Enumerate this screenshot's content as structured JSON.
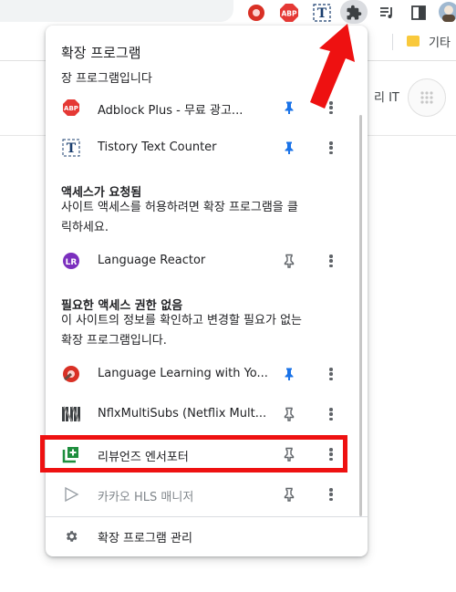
{
  "popup": {
    "title": "확장 프로그램",
    "subtitle": "장 프로그램입니다",
    "pinned": [
      {
        "name": "Adblock Plus - 무료 광고...",
        "icon": "abp-icon",
        "pinned": true
      },
      {
        "name": "Tistory Text Counter",
        "icon": "tistory-t-icon",
        "pinned": true
      }
    ],
    "access_requested": {
      "heading": "액세스가 요청됨",
      "desc_line1": "사이트 액세스를 허용하려면 확장 프로그램을 클",
      "desc_line2": "릭하세요.",
      "items": [
        {
          "name": "Language Reactor",
          "icon": "language-reactor-icon",
          "pinned": false
        }
      ]
    },
    "no_access": {
      "heading": "필요한 액세스 권한 없음",
      "desc_line1": "이 사이트의 정보를 확인하고 변경할 필요가 없는",
      "desc_line2": "확장 프로그램입니다.",
      "items": [
        {
          "name": "Language Learning with Yo...",
          "icon": "language-learning-icon",
          "pinned": true
        },
        {
          "name": "NflxMultiSubs (Netflix Mult...",
          "icon": "nflx-multisubs-icon",
          "pinned": false
        },
        {
          "name": "리뷰언즈 엔서포터",
          "icon": "review-supporter-icon",
          "pinned": false
        },
        {
          "name": "카카오 HLS 매니저",
          "icon": "kakao-hls-icon",
          "pinned": false
        }
      ]
    },
    "manage_label": "확장 프로그램 관리"
  },
  "bookmarks": {
    "folder_label": "기타"
  },
  "page": {
    "partial_text": "리 IT"
  },
  "toolbar": {
    "abp_text": "ABP",
    "tistory_text": "T"
  },
  "colors": {
    "pin_active": "#1a73e8",
    "pin_inactive": "#5f6368",
    "highlight": "#ee1111"
  }
}
